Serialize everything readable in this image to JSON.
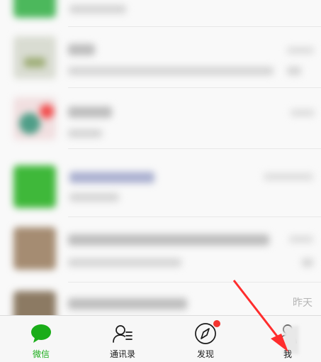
{
  "chat_list": {
    "timestamp_last": "昨天"
  },
  "tabbar": {
    "tabs": [
      {
        "label": "微信",
        "icon": "chat-bubble-icon",
        "active": true
      },
      {
        "label": "通讯录",
        "icon": "contacts-icon",
        "active": false
      },
      {
        "label": "发现",
        "icon": "compass-icon",
        "active": false,
        "has_dot": true
      },
      {
        "label": "我",
        "icon": "person-icon",
        "active": false
      }
    ]
  },
  "colors": {
    "accent": "#1aad19",
    "badge": "#f43530",
    "annotation_arrow": "#ff2d2d"
  }
}
